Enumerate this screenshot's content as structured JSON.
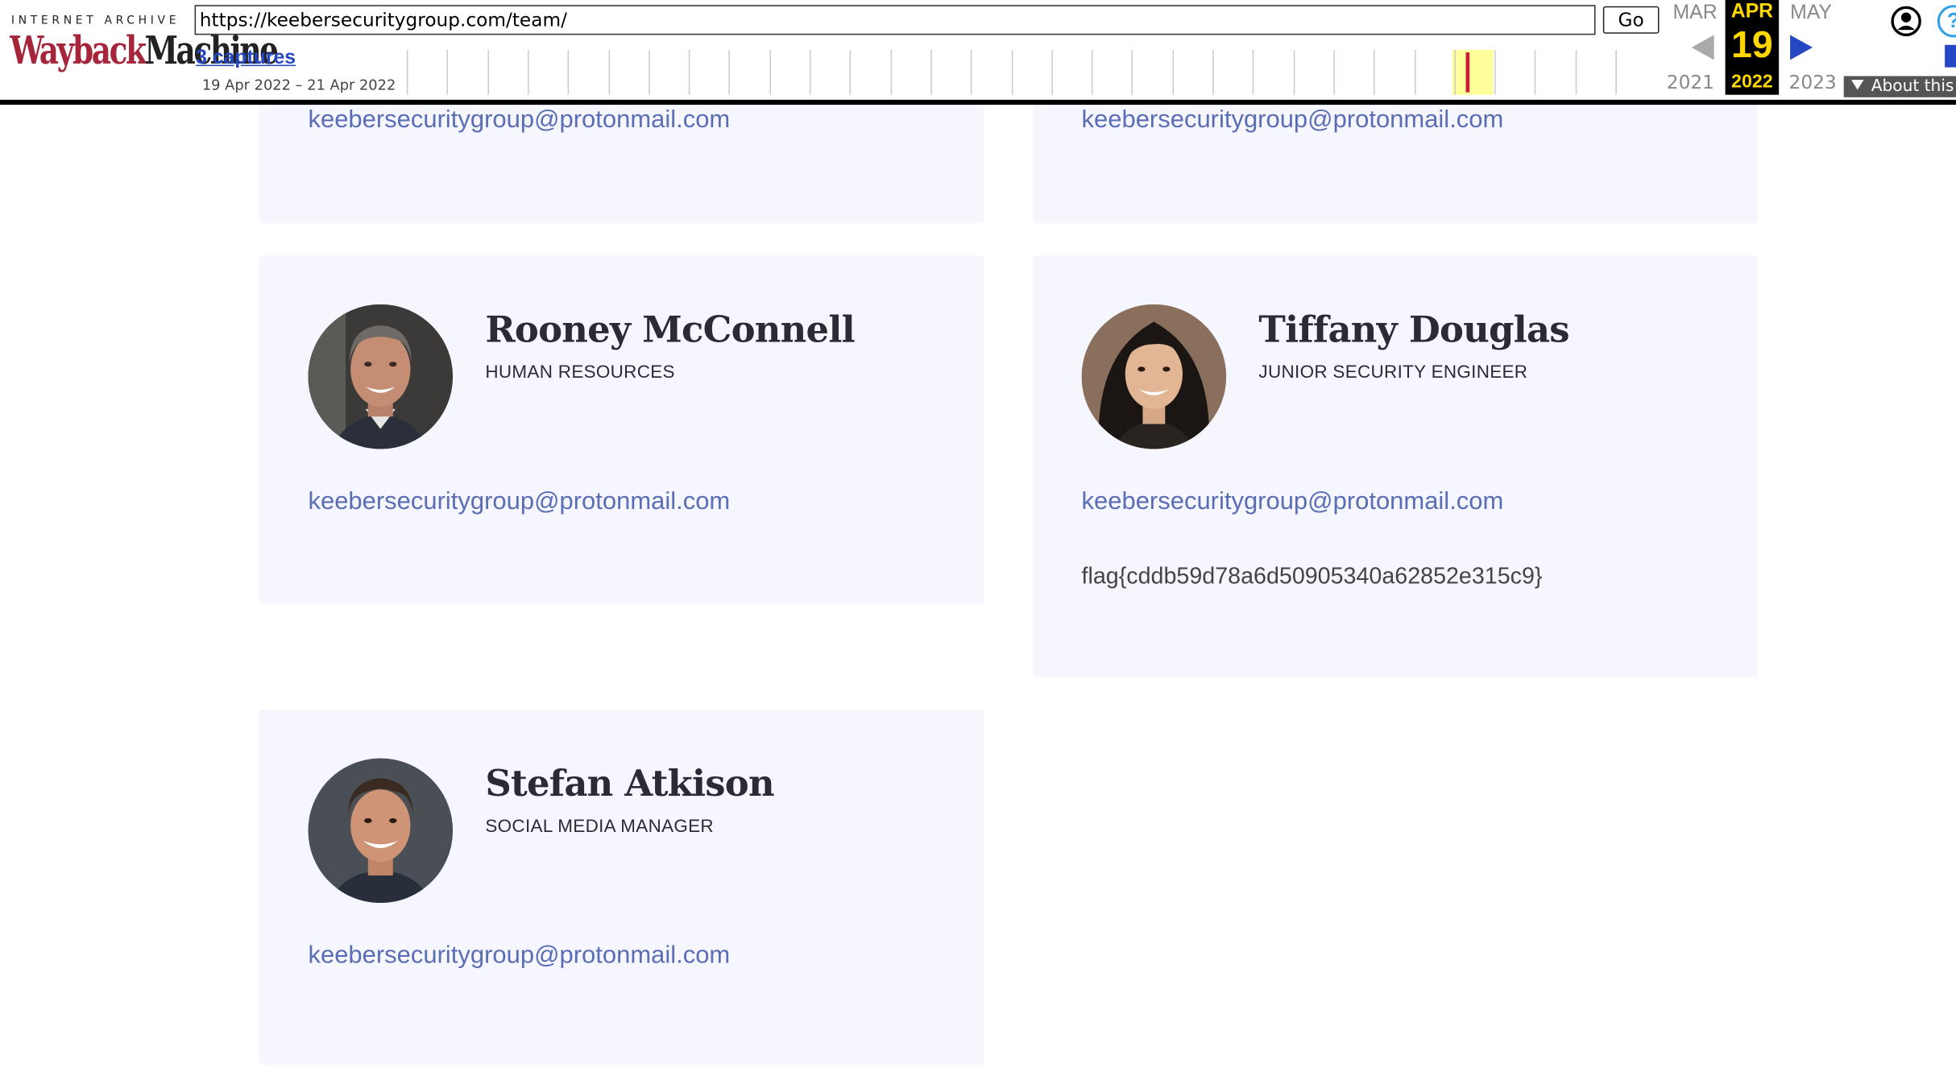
{
  "wayback": {
    "logo_top": "INTERNET ARCHIVE",
    "logo_a": "Wayback",
    "logo_b": "Machine",
    "url": "https://keebersecuritygroup.com/team/",
    "go_label": "Go",
    "captures_label": "3 captures",
    "date_range": "19 Apr 2022 – 21 Apr 2022",
    "prev_month": "MAR",
    "current_month": "APR",
    "next_month": "MAY",
    "prev_year": "2021",
    "current_day": "19",
    "current_year": "2022",
    "next_year": "2023",
    "about_label": "About this capture",
    "help_label": "?"
  },
  "team": {
    "top_left_email": "keebersecuritygroup@protonmail.com",
    "top_right_email": "keebersecuritygroup@protonmail.com",
    "members": [
      {
        "name": "Rooney McConnell",
        "role": "HUMAN RESOURCES",
        "email": "keebersecuritygroup@protonmail.com",
        "extra": ""
      },
      {
        "name": "Tiffany Douglas",
        "role": "JUNIOR SECURITY ENGINEER",
        "email": "keebersecuritygroup@protonmail.com",
        "extra": "flag{cddb59d78a6d50905340a62852e315c9}"
      },
      {
        "name": "Stefan Atkison",
        "role": "SOCIAL MEDIA MANAGER",
        "email": "keebersecuritygroup@protonmail.com",
        "extra": ""
      }
    ]
  },
  "colors": {
    "link": "#5a6db5",
    "card_bg": "#f5f6fe",
    "wayback_current": "#ffd700",
    "capture_marker": "#cf1b3a"
  }
}
